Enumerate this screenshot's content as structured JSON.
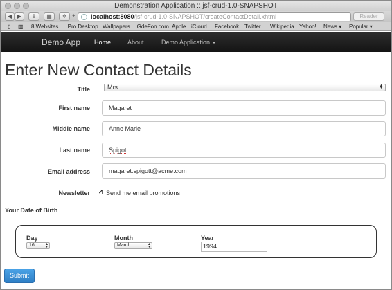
{
  "browser": {
    "window_title": "Demonstration Application :: jsf-crud-1.0-SNAPSHOT",
    "url_host": "localhost:8080",
    "url_path": "/jsf-crud-1.0-SNAPSHOT/createContactDetail.xhtml",
    "reader_label": "Reader",
    "bookmarks": [
      "8 Websites",
      "...Pro Desktop",
      "Wallpapers",
      "...GdeFon.com",
      "Apple",
      "iCloud",
      "Facebook",
      "Twitter",
      "Wikipedia",
      "Yahoo!",
      "News",
      "Popular"
    ]
  },
  "navbar": {
    "brand": "Demo App",
    "items": [
      "Home",
      "About",
      "Demo Application"
    ]
  },
  "page": {
    "title": "Enter New Contact Details"
  },
  "form": {
    "title_label": "Title",
    "title_value": "Mrs",
    "first_name_label": "First name",
    "first_name_value": "Magaret",
    "middle_name_label": "Middle name",
    "middle_name_value": "Anne Marie",
    "last_name_label": "Last name",
    "last_name_value": "Spigott",
    "email_label": "Email address",
    "email_value": "magaret.spigott@acme.com",
    "newsletter_label": "Newsletter",
    "newsletter_checked": true,
    "newsletter_text": "Send me email promotions"
  },
  "dob": {
    "section_title": "Your Date of Birth",
    "day_label": "Day",
    "day_value": "16",
    "month_label": "Month",
    "month_value": "March",
    "year_label": "Year",
    "year_value": "1994"
  },
  "submit_label": "Submit"
}
